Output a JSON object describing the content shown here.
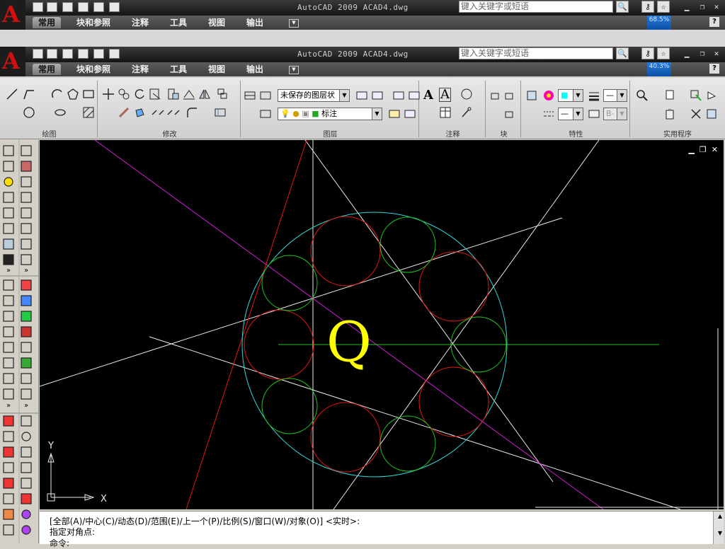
{
  "app": {
    "window_title": "AutoCAD 2009  ACAD4.dwg",
    "search_placeholder": "键入关键字或短语",
    "zoom_top": "68.5%",
    "zoom_second": "40.3%"
  },
  "ribbon_tabs": [
    "常用",
    "块和参照",
    "注释",
    "工具",
    "视图",
    "输出"
  ],
  "ribbon": {
    "layer_combo": "未保存的图层状",
    "dim_combo": "标注",
    "panels": [
      "绘图",
      "修改",
      "图层",
      "注释",
      "块",
      "特性",
      "实用程序"
    ]
  },
  "canvas": {
    "glyph": "Q",
    "ucs_x": "X",
    "ucs_y": "Y"
  },
  "command": {
    "line1": "[全部(A)/中心(C)/动态(D)/范围(E)/上一个(P)/比例(S)/窗口(W)/对象(O)] <实时>:",
    "line2": "指定对角点:",
    "line3": "命令:"
  },
  "colors": {
    "circle_outer": "#33d7d7",
    "circle_red": "#e01818",
    "circle_green": "#22c022",
    "glyph": "#ffff00",
    "magenta": "#d020d0"
  }
}
